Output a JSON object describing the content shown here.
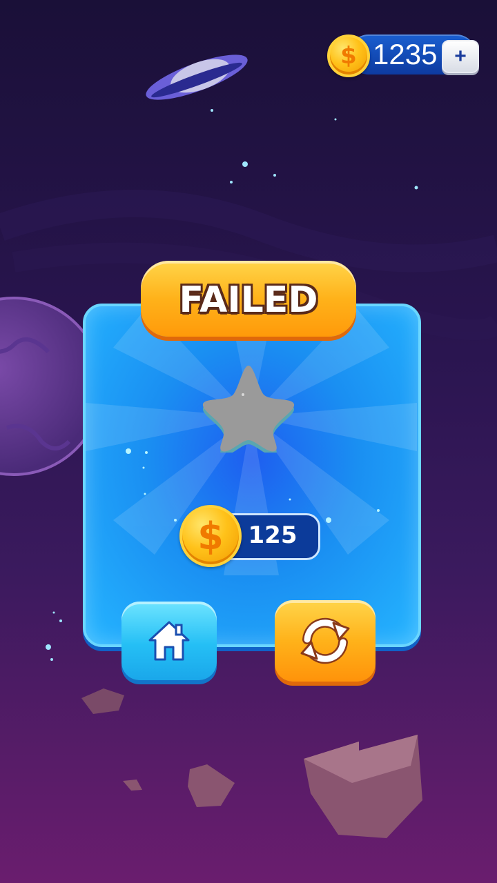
{
  "hud": {
    "coin_total": "1235",
    "coin_symbol": "$",
    "add_coins_label": "+"
  },
  "result": {
    "title": "FAILED",
    "stars_earned": 0,
    "stars_total": 1,
    "reward_value": "125",
    "reward_symbol": "$"
  },
  "actions": {
    "home_icon": "home-icon",
    "retry_icon": "retry-icon"
  },
  "colors": {
    "panel_blue": "#1a8ff2",
    "title_orange": "#ffb21a",
    "coin_gold": "#ffc21a",
    "star_empty": "#9a9a9a"
  }
}
